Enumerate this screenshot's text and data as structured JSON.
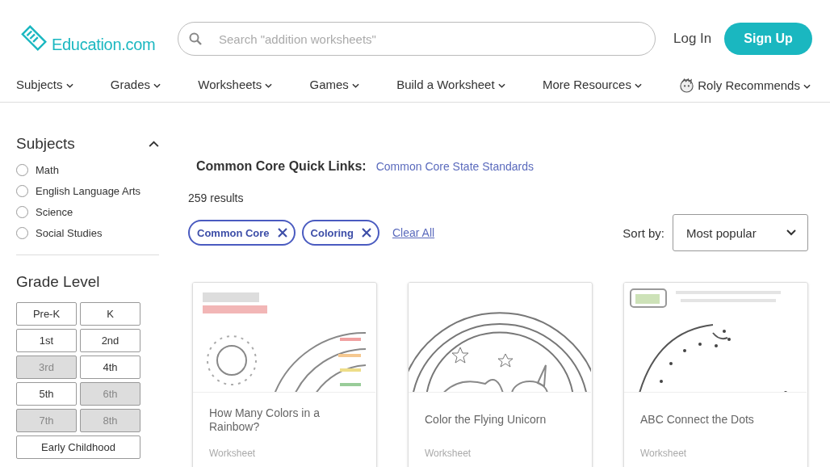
{
  "header": {
    "logo": "Education.com",
    "search": {
      "placeholder": "Search \"addition worksheets\""
    },
    "login": "Log In",
    "signup": "Sign Up"
  },
  "nav": [
    {
      "label": "Subjects",
      "kind": "plain"
    },
    {
      "label": "Grades",
      "kind": "plain"
    },
    {
      "label": "Worksheets",
      "kind": "plain"
    },
    {
      "label": "Games",
      "kind": "plain"
    },
    {
      "label": "Build a Worksheet",
      "kind": "plain"
    },
    {
      "label": "More Resources",
      "kind": "plain"
    },
    {
      "label": "Roly Recommends",
      "kind": "mascot"
    }
  ],
  "sidebar": {
    "subjects": {
      "title": "Subjects",
      "expanded": true,
      "items": [
        {
          "label": "Math",
          "checked": false
        },
        {
          "label": "English Language Arts",
          "checked": false
        },
        {
          "label": "Science",
          "checked": false
        },
        {
          "label": "Social Studies",
          "checked": false
        }
      ]
    },
    "grade_level": {
      "title": "Grade Level",
      "items": [
        {
          "label": "Pre-K",
          "disabled": false,
          "kind": "single"
        },
        {
          "label": "K",
          "disabled": false,
          "kind": "single"
        },
        {
          "label": "1st",
          "disabled": false,
          "kind": "single"
        },
        {
          "label": "2nd",
          "disabled": false,
          "kind": "single"
        },
        {
          "label": "3rd",
          "disabled": true,
          "kind": "single"
        },
        {
          "label": "4th",
          "disabled": false,
          "kind": "single"
        },
        {
          "label": "5th",
          "disabled": false,
          "kind": "single"
        },
        {
          "label": "6th",
          "disabled": true,
          "kind": "single"
        },
        {
          "label": "7th",
          "disabled": true,
          "kind": "single"
        },
        {
          "label": "8th",
          "disabled": true,
          "kind": "single"
        },
        {
          "label": "Early Childhood",
          "disabled": false,
          "kind": "wide"
        }
      ]
    }
  },
  "quick_links": {
    "label": "Common Core Quick Links:",
    "link": "Common Core State Standards"
  },
  "results": "259 results",
  "filters": [
    {
      "label": "Common Core"
    },
    {
      "label": "Coloring"
    }
  ],
  "clear_all": "Clear All",
  "sort": {
    "label": "Sort by:",
    "value": "Most popular"
  },
  "cards": [
    {
      "title": "How Many Colors in a Rainbow?",
      "type": "Worksheet",
      "kind": "rainbow"
    },
    {
      "title": "Color the Flying Unicorn",
      "type": "Worksheet",
      "kind": "unicorn"
    },
    {
      "title": "ABC Connect the Dots",
      "type": "Worksheet",
      "kind": "dots"
    }
  ]
}
